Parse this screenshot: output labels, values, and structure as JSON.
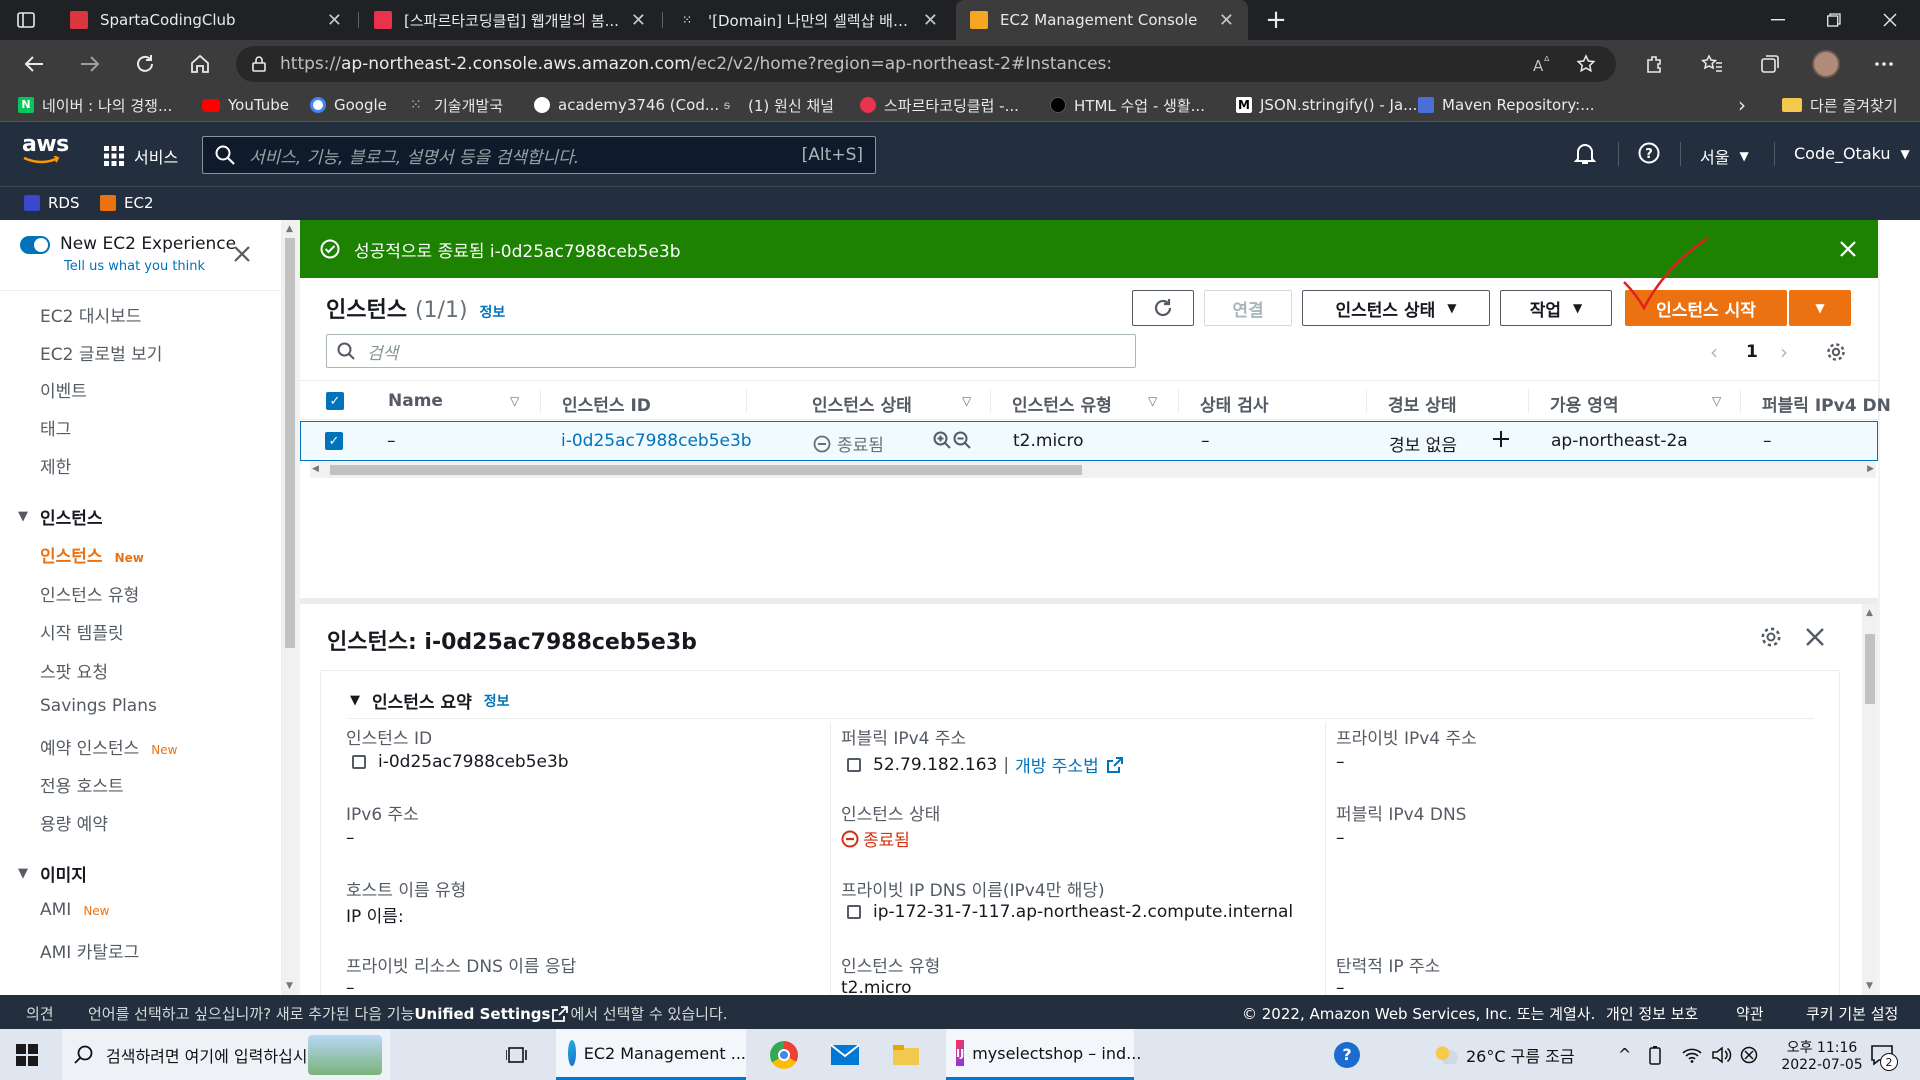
{
  "browser": {
    "tabs": [
      {
        "title": "SpartaCodingClub",
        "icon_color": "#d9363e",
        "close": "✕"
      },
      {
        "title": "[스파르타코딩클럽] 웹개발의 봄...",
        "icon_color": "#e8324e",
        "close": "✕"
      },
      {
        "title": "'[Domain] 나만의 셀렉샵 배포하...",
        "icon_color": "#ffffff",
        "close": "✕"
      },
      {
        "title": "EC2 Management Console",
        "icon_color": "#f5a623",
        "close": "✕"
      }
    ],
    "new_tab": "+",
    "url_prefix": "https://",
    "url_host": "ap-northeast-2.console.aws.amazon.com",
    "url_path": "/ec2/v2/home?region=ap-northeast-2#Instances:",
    "bookmarks": [
      {
        "label": "네이버 : 나의 경쟁...",
        "icon_color": "#03c75a"
      },
      {
        "label": "YouTube",
        "icon_color": "#ff0000"
      },
      {
        "label": "Google",
        "icon_color": "#ffffff"
      },
      {
        "label": "기술개발국",
        "icon_color": "#bbbbbb"
      },
      {
        "label": "academy3746 (Cod...",
        "icon_color": "#ffffff"
      },
      {
        "label": "(1) 원신 채널",
        "icon_color": "#cccccc"
      },
      {
        "label": "스파르타코딩클럽 -...",
        "icon_color": "#e8324e"
      },
      {
        "label": "HTML 수업 - 생활...",
        "icon_color": "#000000"
      },
      {
        "label": "JSON.stringify() - Ja...",
        "icon_color": "#ffffff"
      },
      {
        "label": "Maven Repository:...",
        "icon_color": "#4a6fd8"
      }
    ],
    "bookmarks_more": "다른 즐겨찾기"
  },
  "aws": {
    "logo": "aws",
    "services_label": "서비스",
    "search_placeholder": "서비스, 기능, 블로그, 설명서 등을 검색합니다.",
    "search_shortcut": "[Alt+S]",
    "region": "서울",
    "account": "Code_Otaku",
    "favorites": [
      "RDS",
      "EC2"
    ]
  },
  "sidebar": {
    "toggle_label": "New EC2 Experience",
    "toggle_sub": "Tell us what you think",
    "top_items": [
      "EC2 대시보드",
      "EC2 글로벌 보기",
      "이벤트",
      "태그",
      "제한"
    ],
    "section_instances": "인스턴스",
    "instances_items": [
      {
        "label": "인스턴스",
        "badge": "New",
        "active": true
      },
      {
        "label": "인스턴스 유형",
        "badge": ""
      },
      {
        "label": "시작 템플릿",
        "badge": ""
      },
      {
        "label": "스팟 요청",
        "badge": ""
      },
      {
        "label": "Savings Plans",
        "badge": ""
      },
      {
        "label": "예약 인스턴스",
        "badge": "New"
      },
      {
        "label": "전용 호스트",
        "badge": ""
      },
      {
        "label": "용량 예약",
        "badge": ""
      }
    ],
    "section_images": "이미지",
    "images_items": [
      {
        "label": "AMI",
        "badge": "New"
      },
      {
        "label": "AMI 카탈로그",
        "badge": ""
      }
    ]
  },
  "flash": {
    "message": "성공적으로 종료됨 i-0d25ac7988ceb5e3b"
  },
  "instances": {
    "title": "인스턴스",
    "count": "(1/1)",
    "info": "정보",
    "buttons": {
      "connect": "연결",
      "state": "인스턴스 상태",
      "actions": "작업",
      "launch": "인스턴스 시작"
    },
    "search_placeholder": "검색",
    "page": "1",
    "columns": [
      "Name",
      "인스턴스 ID",
      "인스턴스 상태",
      "인스턴스 유형",
      "상태 검사",
      "경보 상태",
      "가용 영역",
      "퍼블릭 IPv4 DN"
    ],
    "row": {
      "name": "–",
      "id": "i-0d25ac7988ceb5e3b",
      "state": "종료됨",
      "type": "t2.micro",
      "status_check": "–",
      "alarm": "경보 없음",
      "az": "ap-northeast-2a",
      "public_dns": "–"
    }
  },
  "detail": {
    "title": "인스턴스: i-0d25ac7988ceb5e3b",
    "summary_heading": "인스턴스 요약",
    "info": "정보",
    "fields": {
      "instance_id_label": "인스턴스 ID",
      "instance_id": "i-0d25ac7988ceb5e3b",
      "public_ipv4_label": "퍼블릭 IPv4 주소",
      "public_ipv4": "52.79.182.163",
      "open_address": "개방 주소법",
      "private_ipv4_label": "프라이빗 IPv4 주소",
      "private_ipv4": "–",
      "ipv6_label": "IPv6 주소",
      "ipv6": "–",
      "state_label": "인스턴스 상태",
      "state": "종료됨",
      "public_dns_label": "퍼블릭 IPv4 DNS",
      "public_dns": "–",
      "hostname_type_label": "호스트 이름 유형",
      "hostname_type": "IP 이름:",
      "private_dns_label": "프라이빗 IP DNS 이름(IPv4만 해당)",
      "private_dns": "ip-172-31-7-117.ap-northeast-2.compute.internal",
      "private_resource_dns_label": "프라이빗 리소스 DNS 이름 응답",
      "private_resource_dns": "–",
      "instance_type_label": "인스턴스 유형",
      "instance_type": "t2.micro",
      "elastic_ip_label": "탄력적 IP 주소",
      "elastic_ip": "–"
    }
  },
  "footer": {
    "feedback": "의견",
    "language_prompt_pre": "언어를 선택하고 싶으십니까? 새로 추가된 다음 기능",
    "unified": "Unified Settings",
    "language_prompt_post": "에서 선택할 수 있습니다.",
    "copyright": "© 2022, Amazon Web Services, Inc. 또는 계열사.",
    "privacy": "개인 정보 보호",
    "terms": "약관",
    "cookies": "쿠키 기본 설정"
  },
  "taskbar": {
    "search_placeholder": "검색하려면 여기에 입력하십시",
    "apps": [
      {
        "label": "EC2 Management ..."
      },
      {
        "label": "myselectshop – ind..."
      }
    ],
    "weather": "26°C  구름 조금",
    "ampm": "오후 11:16",
    "date": "2022-07-05",
    "notifications": "2"
  },
  "colors": {
    "aws_nav": "#232f3e",
    "success": "#1d8102",
    "primary": "#ec7211",
    "link": "#0073bb",
    "danger": "#d13212"
  }
}
